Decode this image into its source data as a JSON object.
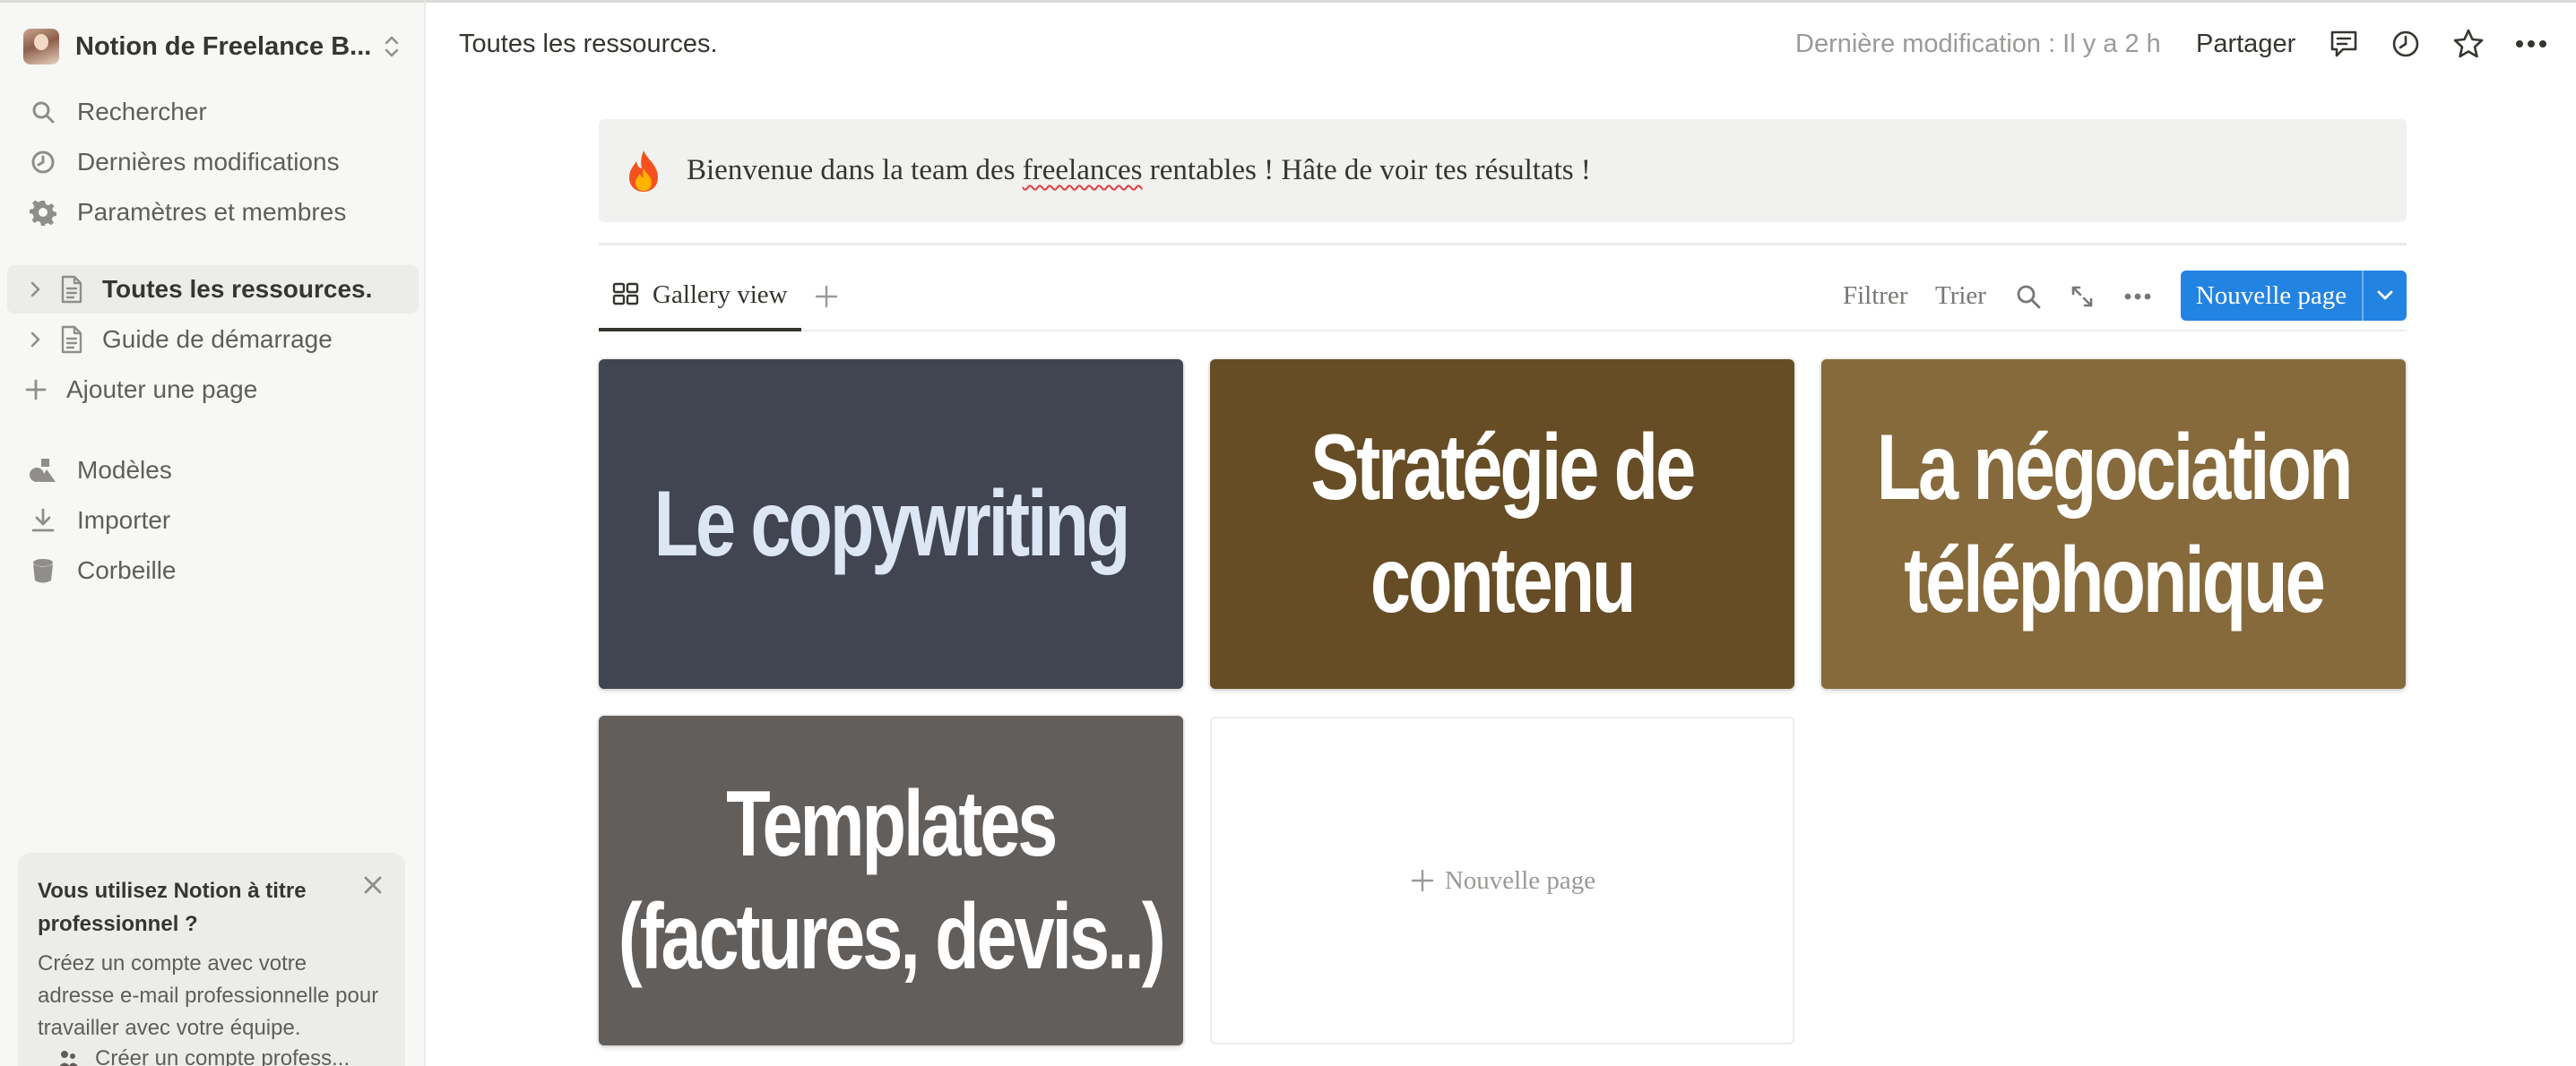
{
  "sidebar": {
    "workspace_name": "Notion de Freelance B...",
    "nav": [
      {
        "label": "Rechercher",
        "icon": "search-icon"
      },
      {
        "label": "Dernières modifications",
        "icon": "clock-icon"
      },
      {
        "label": "Paramètres et membres",
        "icon": "gear-icon"
      }
    ],
    "pages": [
      {
        "label": "Toutes les ressources.",
        "icon": "page-icon",
        "active": true
      },
      {
        "label": "Guide de démarrage",
        "icon": "page-icon",
        "active": false
      }
    ],
    "add_page_label": "Ajouter une page",
    "tools": [
      {
        "label": "Modèles",
        "icon": "shapes-icon"
      },
      {
        "label": "Importer",
        "icon": "import-icon"
      },
      {
        "label": "Corbeille",
        "icon": "trash-icon"
      }
    ],
    "promo": {
      "title": "Vous utilisez Notion à titre professionnel ?",
      "body": "Créez un compte avec votre adresse e-mail professionnelle pour travailler avec votre équipe.",
      "cta": "Créer un compte profess..."
    }
  },
  "topbar": {
    "breadcrumb": "Toutes les ressources.",
    "last_edited": "Dernière modification : Il y a 2 h",
    "share_label": "Partager"
  },
  "callout": {
    "emoji": "fire-emoji",
    "text_before": "Bienvenue dans la team des ",
    "text_flagged": "freelances",
    "text_after": " rentables ! Hâte de voir tes résultats !"
  },
  "view": {
    "tab_label": "Gallery view",
    "filter_label": "Filtrer",
    "sort_label": "Trier",
    "new_page_label": "Nouvelle page"
  },
  "gallery": {
    "cards": [
      {
        "lines": [
          "Le copywriting"
        ],
        "bg": "#414551",
        "fg": "#dde6f4"
      },
      {
        "lines": [
          "Stratégie de",
          "contenu"
        ],
        "bg": "#664d25",
        "fg": "#ffffff"
      },
      {
        "lines": [
          "La négociation",
          "téléphonique"
        ],
        "bg": "#866a3b",
        "fg": "#ffffff"
      },
      {
        "lines": [
          "Templates",
          "(factures, devis..)"
        ],
        "bg": "#625e5c",
        "fg": "#ffffff"
      }
    ],
    "new_card_label": "Nouvelle page"
  },
  "colors": {
    "accent": "#2383e2",
    "sidebar_bg": "#f7f7f5",
    "callout_bg": "#f1f1ef"
  }
}
